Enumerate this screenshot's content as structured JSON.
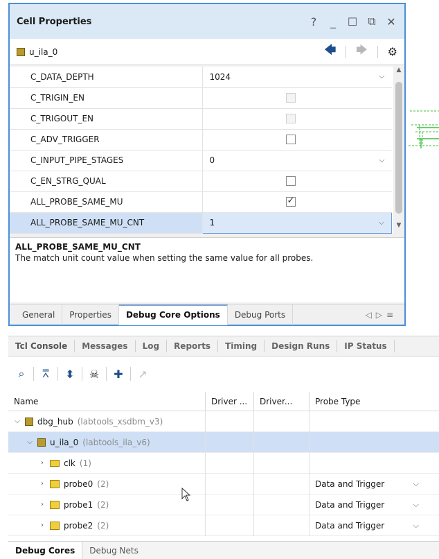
{
  "cell_properties": {
    "title": "Cell Properties",
    "window_controls": [
      "?",
      "_",
      "☐",
      "⧉",
      "✕"
    ],
    "cell_name": "u_ila_0",
    "properties": [
      {
        "name": "C_DATA_DEPTH",
        "value": "1024",
        "kind": "dropdown"
      },
      {
        "name": "C_TRIGIN_EN",
        "kind": "checkbox",
        "checked": false,
        "disabled": true
      },
      {
        "name": "C_TRIGOUT_EN",
        "kind": "checkbox",
        "checked": false,
        "disabled": true
      },
      {
        "name": "C_ADV_TRIGGER",
        "kind": "checkbox",
        "checked": false,
        "disabled": false
      },
      {
        "name": "C_INPUT_PIPE_STAGES",
        "value": "0",
        "kind": "dropdown"
      },
      {
        "name": "C_EN_STRG_QUAL",
        "kind": "checkbox",
        "checked": false,
        "disabled": false
      },
      {
        "name": "ALL_PROBE_SAME_MU",
        "kind": "checkbox",
        "checked": true,
        "disabled": false
      },
      {
        "name": "ALL_PROBE_SAME_MU_CNT",
        "value": "1",
        "kind": "dropdown",
        "selected": true
      }
    ],
    "description": {
      "title": "ALL_PROBE_SAME_MU_CNT",
      "text": "The match unit count value when setting the same value for all probes."
    },
    "tabs": [
      "General",
      "Properties",
      "Debug Core Options",
      "Debug Ports"
    ],
    "active_tab": "Debug Core Options"
  },
  "console_tabs": [
    "Tcl Console",
    "Messages",
    "Log",
    "Reports",
    "Timing",
    "Design Runs",
    "IP Status"
  ],
  "debug_tree": {
    "columns": [
      "Name",
      "Driver ...",
      "Driver...",
      "Probe Type"
    ],
    "rows": [
      {
        "name": "dbg_hub",
        "detail": "(labtools_xsdbm_v3)",
        "probe_type": ""
      },
      {
        "name": "u_ila_0",
        "detail": "(labtools_ila_v6)",
        "probe_type": ""
      },
      {
        "name": "clk",
        "detail": "(1)",
        "probe_type": ""
      },
      {
        "name": "probe0",
        "detail": "(2)",
        "probe_type": "Data and Trigger"
      },
      {
        "name": "probe1",
        "detail": "(2)",
        "probe_type": "Data and Trigger"
      },
      {
        "name": "probe2",
        "detail": "(2)",
        "probe_type": "Data and Trigger"
      }
    ]
  },
  "bottom_tabs": [
    "Debug Cores",
    "Debug Nets"
  ],
  "colors": {
    "accent": "#4a8fd6",
    "selection": "#cfe0f6"
  }
}
